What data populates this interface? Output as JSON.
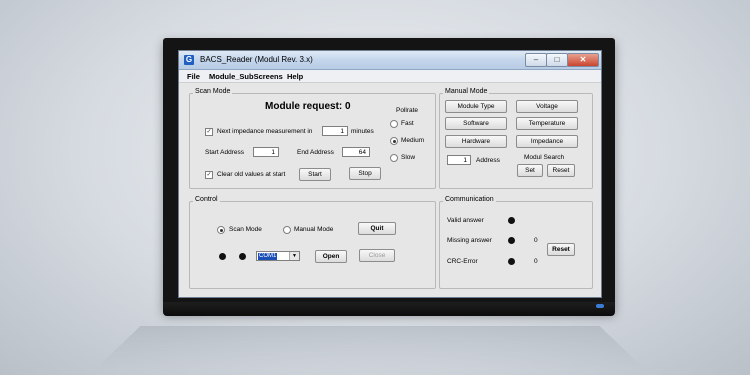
{
  "window": {
    "icon_letter": "G",
    "title": "BACS_Reader (Modul Rev. 3.x)",
    "controls": {
      "minimize": "–",
      "maximize": "□",
      "close": "✕"
    }
  },
  "menu": {
    "file": "File",
    "subscreens": "Module_SubScreens",
    "help": "Help"
  },
  "scan_mode": {
    "label": "Scan Mode",
    "module_request": "Module request: 0",
    "next_impedance_label": "Next impedance measurement in",
    "next_impedance_value": "1",
    "minutes_label": "minutes",
    "start_address_label": "Start Address",
    "start_address_value": "1",
    "end_address_label": "End Address",
    "end_address_value": "64",
    "clear_old_label": "Clear old values at start",
    "start_button": "Start",
    "stop_button": "Stop",
    "pollrate_label": "Pollrate",
    "pollrate_fast": "Fast",
    "pollrate_medium": "Medium",
    "pollrate_slow": "Slow",
    "pollrate_selected": "Medium",
    "next_impedance_checked": true,
    "clear_old_checked": true
  },
  "manual_mode": {
    "label": "Manual Mode",
    "module_type": "Module Type",
    "voltage": "Voltage",
    "software": "Software",
    "temperature": "Temperature",
    "hardware": "Hardware",
    "impedance": "Impedance",
    "address_value": "1",
    "address_label": "Address",
    "modul_search_label": "Modul Search",
    "set_button": "Set",
    "reset_button": "Reset"
  },
  "control": {
    "label": "Control",
    "scan_mode_radio": "Scan Mode",
    "manual_mode_radio": "Manual Mode",
    "selected_mode": "Scan Mode",
    "quit_button": "Quit",
    "com_port": "COM1",
    "open_button": "Open",
    "close_button": "Close"
  },
  "communication": {
    "label": "Communication",
    "valid_answer_label": "Valid answer",
    "missing_answer_label": "Missing answer",
    "missing_answer_count": "0",
    "crc_error_label": "CRC-Error",
    "crc_error_count": "0",
    "reset_button": "Reset"
  },
  "colors": {
    "title_bar": "#c4d6ec",
    "window_bg": "#e6e6e6",
    "selection": "#1a4fb8",
    "close_button": "#c9452f",
    "indicator": "#111111"
  }
}
